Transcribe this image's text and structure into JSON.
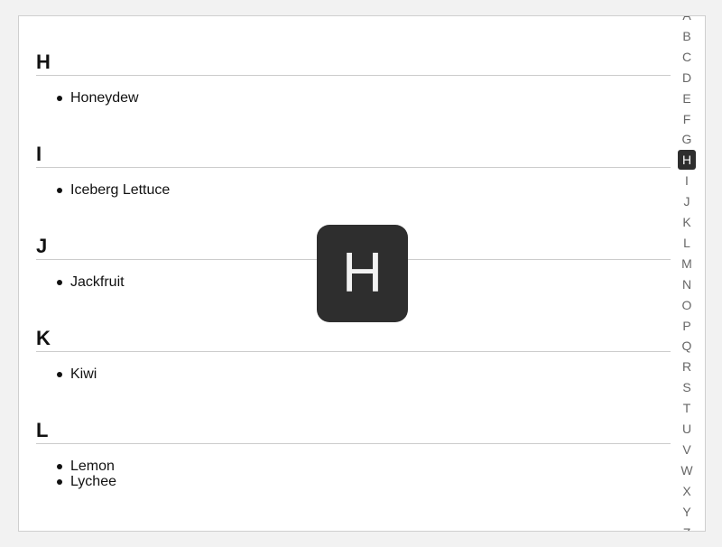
{
  "sections": [
    {
      "letter": "H",
      "items": [
        "Honeydew"
      ]
    },
    {
      "letter": "I",
      "items": [
        "Iceberg Lettuce"
      ]
    },
    {
      "letter": "J",
      "items": [
        "Jackfruit"
      ]
    },
    {
      "letter": "K",
      "items": [
        "Kiwi"
      ]
    },
    {
      "letter": "L",
      "items": [
        "Lemon",
        "Lychee"
      ]
    }
  ],
  "index_bar": {
    "letters": [
      "A",
      "B",
      "C",
      "D",
      "E",
      "F",
      "G",
      "H",
      "I",
      "J",
      "K",
      "L",
      "M",
      "N",
      "O",
      "P",
      "Q",
      "R",
      "S",
      "T",
      "U",
      "V",
      "W",
      "X",
      "Y",
      "Z"
    ],
    "active": "H"
  },
  "overlay": {
    "letter": "H"
  },
  "colors": {
    "active_bg": "#2e2e2e",
    "index_text": "#666666",
    "divider": "#cccccc",
    "page_bg": "#f2f2f2"
  }
}
